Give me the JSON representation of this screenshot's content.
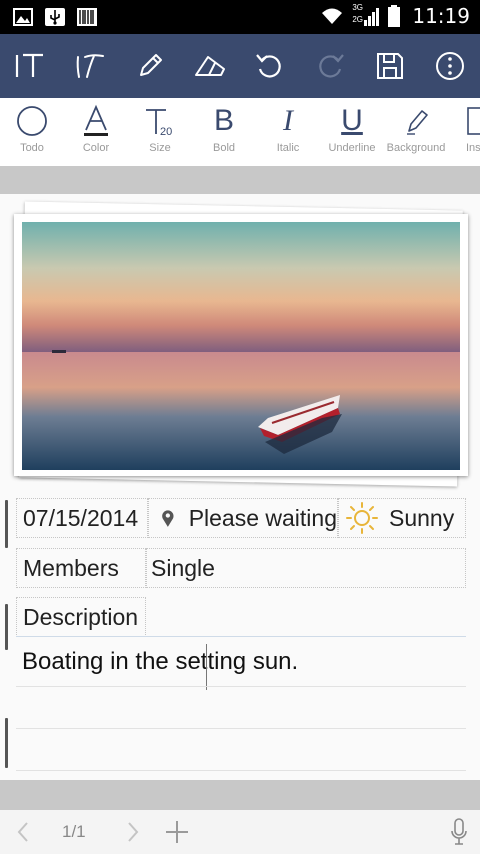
{
  "status_bar": {
    "time": "11:19",
    "network_label_top": "3G",
    "network_label_bottom": "2G",
    "icons": [
      "gallery-notification-icon",
      "usb-icon",
      "barcode-icon",
      "wifi-icon",
      "signal-icon",
      "battery-icon"
    ]
  },
  "toolbar": {
    "icons": [
      "text-mode-icon",
      "handwriting-icon",
      "pencil-icon",
      "eraser-icon",
      "undo-icon",
      "redo-icon",
      "save-icon",
      "more-options-icon"
    ],
    "colors": {
      "background": "#3a4a6e",
      "icon": "#ffffff",
      "disabled_icon": "#6c7a98"
    }
  },
  "format_bar": {
    "items": [
      {
        "label": "Todo",
        "icon": "circle-icon"
      },
      {
        "label": "Color",
        "icon": "color-a-icon"
      },
      {
        "label": "Size",
        "icon": "size-t-icon",
        "size_value": "20"
      },
      {
        "label": "Bold",
        "icon": "bold-b-icon",
        "glyph": "B"
      },
      {
        "label": "Italic",
        "icon": "italic-i-icon",
        "glyph": "I"
      },
      {
        "label": "Underline",
        "icon": "underline-u-icon",
        "glyph": "U"
      },
      {
        "label": "Background",
        "icon": "highlighter-icon"
      },
      {
        "label": "Ins",
        "icon": "insert-icon"
      }
    ],
    "colors": {
      "icon": "#3a4a6e",
      "label": "#9a9a9a"
    }
  },
  "note": {
    "date": "07/15/2014",
    "location": "Please waiting",
    "weather": "Sunny",
    "weather_icon": "sun-icon",
    "location_icon": "location-pin-icon",
    "members_label": "Members",
    "members_value": "Single",
    "description_label": "Description",
    "description_text": "Boating in the setting sun."
  },
  "bottom_bar": {
    "page_indicator": "1/1",
    "icons": [
      "prev-page-icon",
      "next-page-icon",
      "add-page-icon",
      "microphone-icon"
    ]
  }
}
